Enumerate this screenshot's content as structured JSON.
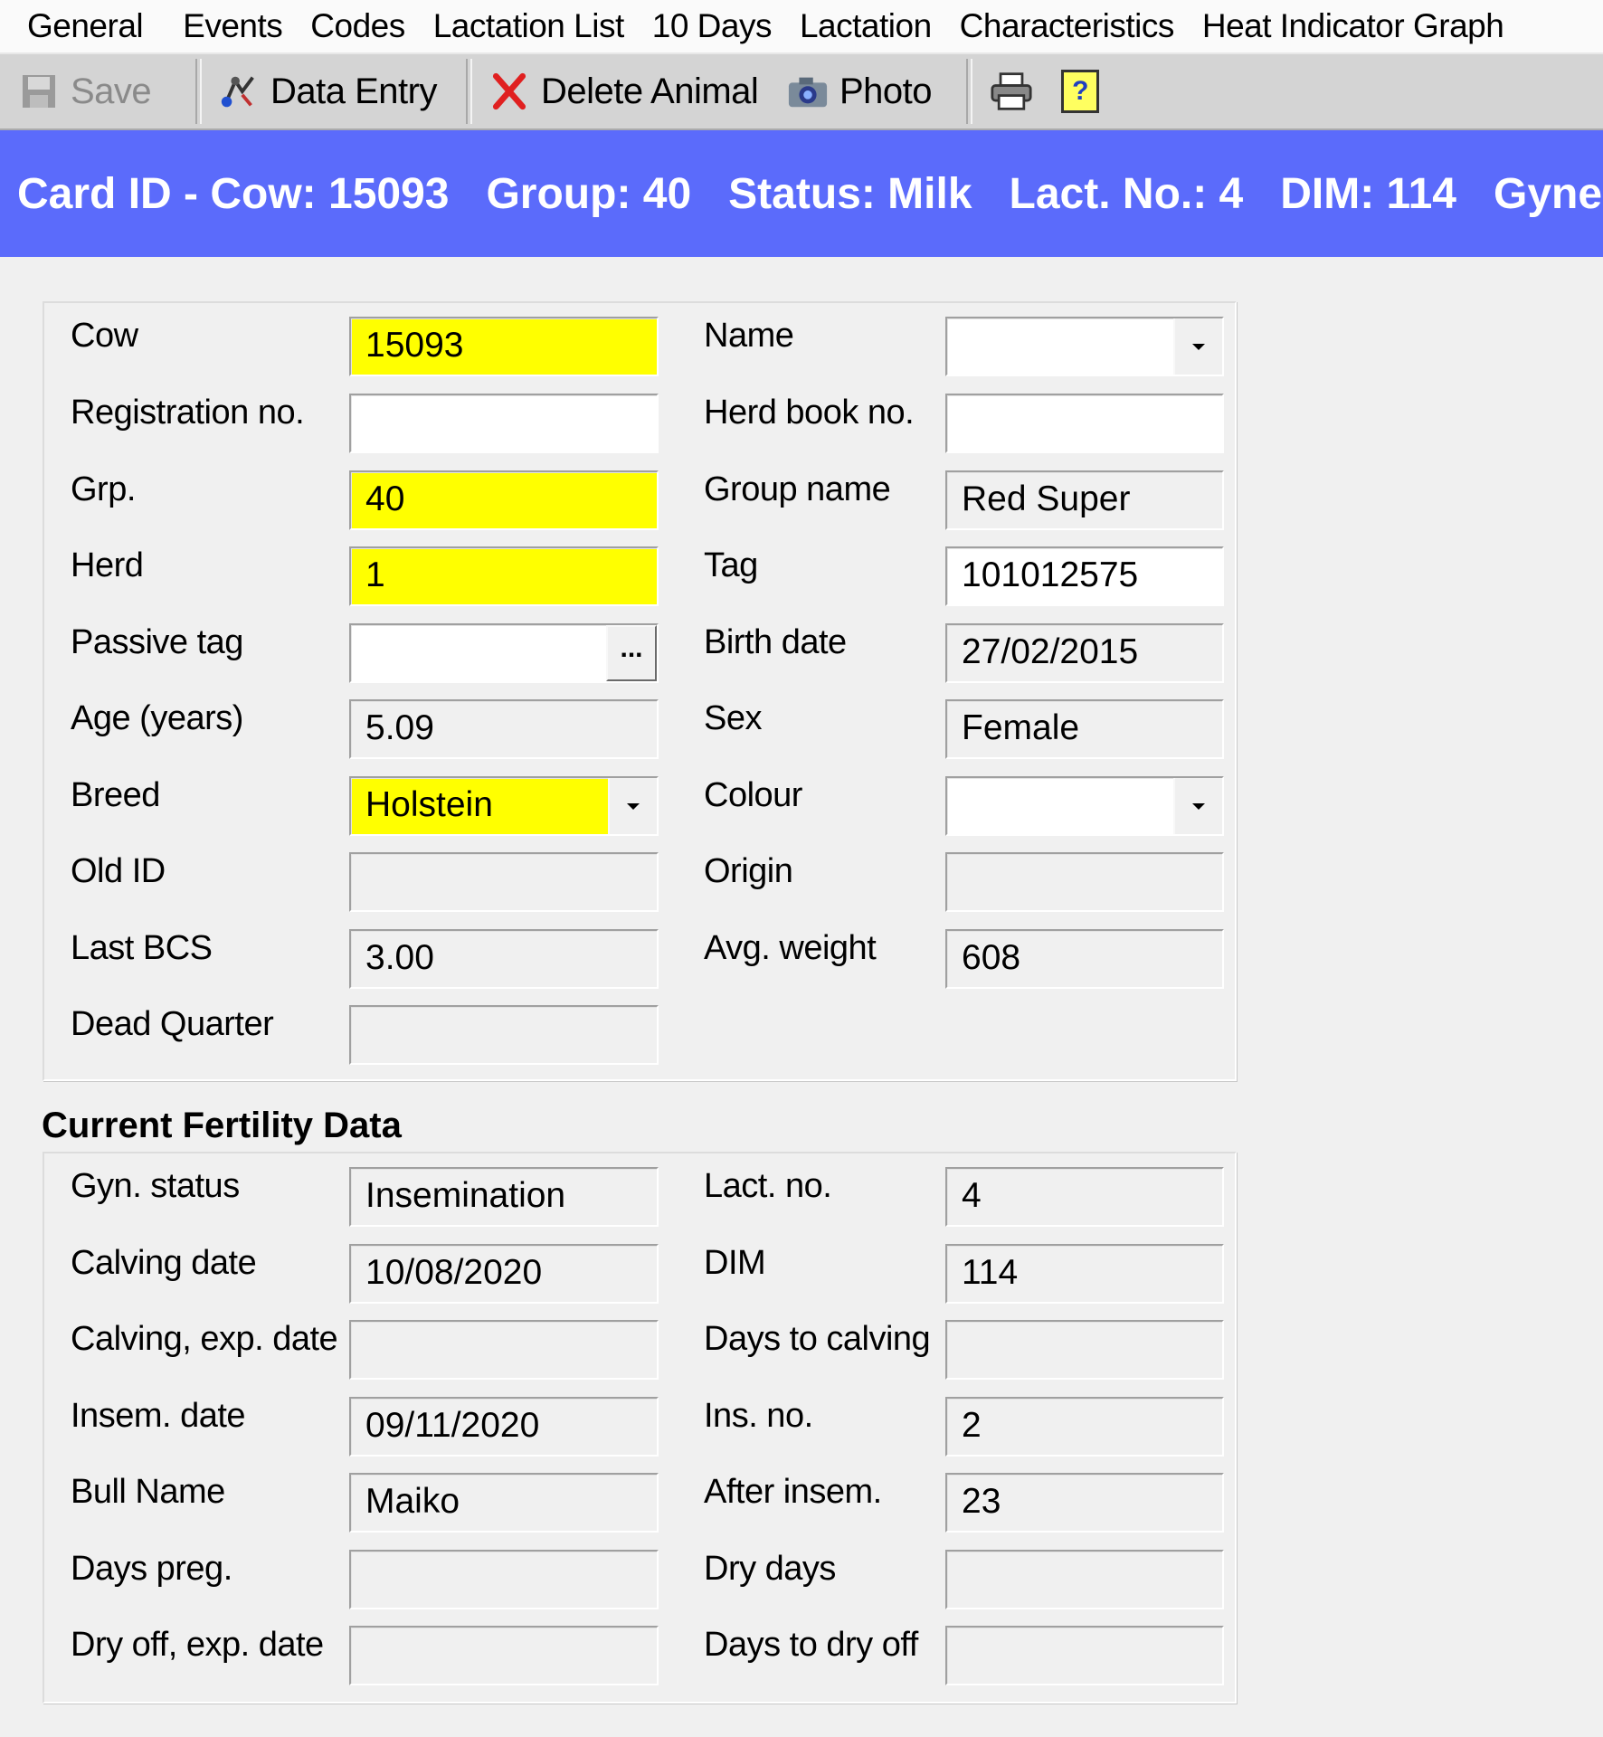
{
  "menu": [
    "General",
    "Events",
    "Codes",
    "Lactation List",
    "10 Days",
    "Lactation",
    "Characteristics",
    "Heat Indicator Graph"
  ],
  "toolbar": {
    "save": "Save",
    "data_entry": "Data Entry",
    "delete_animal": "Delete Animal",
    "photo": "Photo",
    "help_glyph": "?"
  },
  "banner": {
    "card": "Card ID - Cow: 15093",
    "group": "Group: 40",
    "status": "Status: Milk",
    "lact": "Lact. No.: 4",
    "dim": "DIM: 114",
    "gyn": "Gyne"
  },
  "animal": {
    "cow": {
      "label": "Cow",
      "value": "15093"
    },
    "name": {
      "label": "Name",
      "value": ""
    },
    "registration": {
      "label": "Registration no.",
      "value": ""
    },
    "herd_book": {
      "label": "Herd book no.",
      "value": ""
    },
    "grp": {
      "label": "Grp.",
      "value": "40"
    },
    "group_name": {
      "label": "Group name",
      "value": "Red Super"
    },
    "herd": {
      "label": "Herd",
      "value": "1"
    },
    "tag": {
      "label": "Tag",
      "value": "101012575"
    },
    "passive_tag": {
      "label": "Passive tag",
      "value": "",
      "button": "..."
    },
    "birth_date": {
      "label": "Birth date",
      "value": "27/02/2015"
    },
    "age": {
      "label": "Age (years)",
      "value": "5.09"
    },
    "sex": {
      "label": "Sex",
      "value": "Female"
    },
    "breed": {
      "label": "Breed",
      "value": "Holstein"
    },
    "colour": {
      "label": "Colour",
      "value": ""
    },
    "old_id": {
      "label": "Old ID",
      "value": ""
    },
    "origin": {
      "label": "Origin",
      "value": ""
    },
    "last_bcs": {
      "label": "Last BCS",
      "value": "3.00"
    },
    "avg_weight": {
      "label": "Avg. weight",
      "value": "608"
    },
    "dead_quarter": {
      "label": "Dead Quarter",
      "value": ""
    }
  },
  "fertility": {
    "title": "Current Fertility Data",
    "gyn_status": {
      "label": "Gyn. status",
      "value": "Insemination"
    },
    "lact_no": {
      "label": "Lact. no.",
      "value": "4"
    },
    "calving_date": {
      "label": "Calving date",
      "value": "10/08/2020"
    },
    "dim": {
      "label": "DIM",
      "value": "114"
    },
    "calving_exp": {
      "label": "Calving, exp. date",
      "value": ""
    },
    "days_to_calving": {
      "label": "Days to calving",
      "value": ""
    },
    "insem_date": {
      "label": "Insem. date",
      "value": "09/11/2020"
    },
    "ins_no": {
      "label": "Ins. no.",
      "value": "2"
    },
    "bull_name": {
      "label": "Bull Name",
      "value": "Maiko"
    },
    "after_insem": {
      "label": "After insem.",
      "value": "23"
    },
    "days_preg": {
      "label": "Days preg.",
      "value": ""
    },
    "dry_days": {
      "label": "Dry days",
      "value": ""
    },
    "dry_off_exp": {
      "label": "Dry off, exp. date",
      "value": ""
    },
    "days_to_dry_off": {
      "label": "Days to dry off",
      "value": ""
    }
  },
  "colors": {
    "banner": "#5b6bfb",
    "required_field": "#ffff00",
    "window": "#f0f0f0"
  },
  "icons": [
    "save-icon",
    "data-entry-icon",
    "delete-x-icon",
    "camera-icon",
    "printer-icon",
    "help-icon"
  ]
}
